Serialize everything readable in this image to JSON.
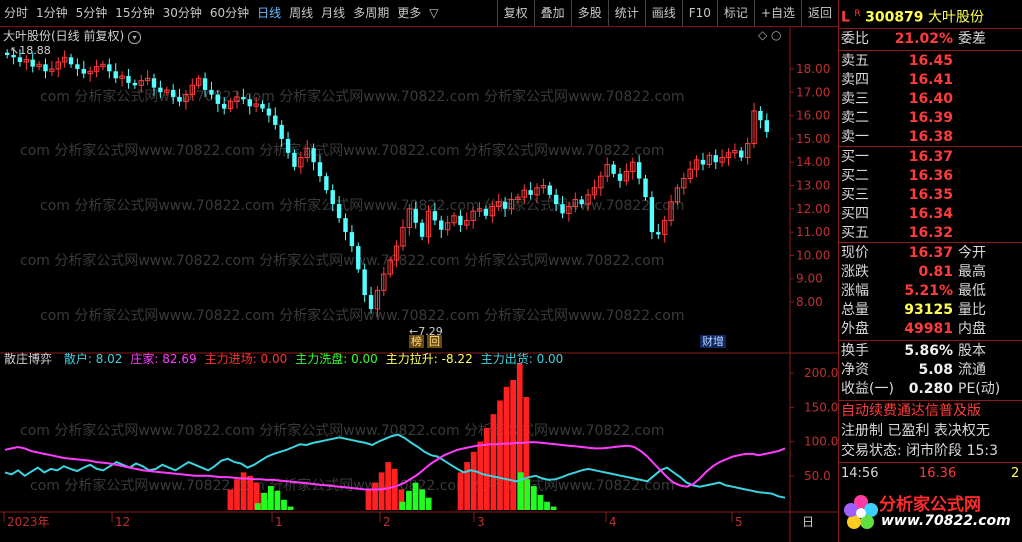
{
  "toolbar": {
    "left": [
      "分时",
      "1分钟",
      "5分钟",
      "15分钟",
      "30分钟",
      "60分钟",
      "日线",
      "周线",
      "月线",
      "多周期",
      "更多"
    ],
    "more_arrow": "▽",
    "right": [
      "复权",
      "叠加",
      "多股",
      "统计",
      "画线",
      "F10",
      "标记",
      "+自选",
      "返回"
    ]
  },
  "main_panel": {
    "title": "大叶股份(日线 前复权)",
    "high_label": "18.88",
    "low_label": "7.29",
    "badges": [
      "榜",
      "回"
    ],
    "event_badge": "财增",
    "watermark": "com 分析家公式网www.70822.com 分析家公式网www.70822.com 分析家公式网www.70822.com"
  },
  "indicator": {
    "name": "散庄博弈",
    "items": [
      {
        "label": "散户: 8.02",
        "color": "#3cd3e0"
      },
      {
        "label": "庄家: 82.69",
        "color": "#ff3cff"
      },
      {
        "label": "主力进场: 0.00",
        "color": "#ff3333"
      },
      {
        "label": "主力洗盘: 0.00",
        "color": "#33ff33"
      },
      {
        "label": "主力拉升: -8.22",
        "color": "#ffff55"
      },
      {
        "label": "主力出货: 0.00",
        "color": "#3cd3e0"
      }
    ]
  },
  "x_axis": [
    "2023年",
    "12",
    "1",
    "2",
    "3",
    "4",
    "5"
  ],
  "x_axis_end": "日",
  "chart_data": [
    {
      "type": "candlestick",
      "title": "大叶股份(日线 前复权)",
      "y_ticks": [
        18.0,
        17.0,
        16.0,
        15.0,
        14.0,
        13.0,
        12.0,
        11.0,
        10.0,
        9.0,
        8.0
      ],
      "ylim": [
        7.1,
        19.2
      ],
      "annotations": {
        "max": 18.88,
        "min": 7.29
      },
      "closes": [
        18.6,
        18.5,
        18.3,
        18.4,
        18.1,
        18.2,
        17.9,
        18.0,
        18.3,
        18.5,
        18.2,
        18.0,
        17.8,
        17.9,
        18.1,
        18.2,
        17.9,
        17.6,
        17.7,
        17.4,
        17.3,
        17.5,
        17.6,
        17.2,
        17.0,
        17.1,
        16.8,
        16.6,
        16.9,
        17.3,
        17.6,
        17.1,
        16.9,
        16.5,
        16.3,
        16.6,
        16.8,
        16.7,
        16.4,
        16.5,
        16.3,
        16.0,
        15.6,
        15.0,
        14.4,
        13.8,
        14.2,
        14.6,
        14.0,
        13.4,
        12.8,
        12.2,
        11.6,
        11.0,
        10.4,
        9.4,
        8.3,
        7.7,
        8.5,
        9.2,
        9.8,
        10.4,
        11.2,
        12.0,
        11.4,
        10.8,
        11.9,
        11.5,
        11.1,
        11.4,
        11.7,
        11.3,
        11.5,
        11.9,
        12.0,
        11.7,
        12.1,
        12.3,
        12.0,
        12.4,
        12.5,
        12.8,
        12.6,
        12.9,
        13.0,
        12.6,
        12.2,
        11.8,
        12.1,
        12.4,
        12.2,
        12.6,
        12.9,
        13.4,
        13.9,
        13.5,
        13.2,
        13.6,
        14.0,
        13.3,
        12.5,
        11.0,
        10.9,
        11.5,
        12.3,
        12.9,
        13.3,
        13.7,
        14.1,
        13.9,
        14.3,
        14.0,
        14.2,
        14.4,
        14.5,
        14.2,
        14.8,
        16.2,
        15.8,
        15.3
      ],
      "y2_ticks": [
        200.0,
        150.0,
        100.0,
        50.0
      ],
      "y2lim": [
        0,
        225
      ],
      "series": [
        {
          "name": "散户",
          "color": "#3cd3e0",
          "values": [
            55,
            52,
            58,
            50,
            56,
            62,
            55,
            60,
            58,
            64,
            60,
            57,
            62,
            66,
            60,
            58,
            64,
            70,
            66,
            62,
            68,
            64,
            58,
            60,
            66,
            62,
            58,
            64,
            70,
            66,
            62,
            58,
            64,
            72,
            75,
            70,
            68,
            62,
            66,
            72,
            78,
            82,
            85,
            88,
            92,
            96,
            95,
            98,
            100,
            102,
            104,
            106,
            104,
            102,
            100,
            98,
            95,
            100,
            104,
            108,
            110,
            105,
            98,
            92,
            85,
            80,
            78,
            72,
            66,
            60,
            55,
            58,
            56,
            52,
            50,
            48,
            46,
            44,
            42,
            45,
            48,
            50,
            46,
            44,
            45,
            48,
            52,
            55,
            58,
            60,
            58,
            56,
            54,
            52,
            50,
            48,
            46,
            44,
            42,
            50,
            58,
            62,
            55,
            48,
            40,
            36,
            34,
            36,
            38,
            40,
            36,
            34,
            32,
            30,
            28,
            26,
            25,
            24,
            20,
            18
          ]
        },
        {
          "name": "庄家",
          "color": "#ff3cff",
          "values": [
            88,
            90,
            92,
            90,
            86,
            84,
            82,
            80,
            78,
            76,
            75,
            74,
            73,
            72,
            70,
            69,
            68,
            66,
            64,
            62,
            60,
            58,
            57,
            56,
            55,
            54,
            53,
            52,
            51,
            50,
            50,
            50,
            49,
            48,
            48,
            47,
            46,
            46,
            45,
            45,
            44,
            44,
            43,
            42,
            41,
            40,
            39,
            38,
            37,
            36,
            35,
            34,
            33,
            32,
            31,
            30,
            30,
            30,
            31,
            33,
            36,
            40,
            46,
            52,
            60,
            68,
            74,
            80,
            84,
            88,
            90,
            92,
            94,
            95,
            96,
            96,
            97,
            97,
            98,
            98,
            99,
            99,
            98,
            97,
            96,
            95,
            94,
            93,
            92,
            91,
            90,
            90,
            91,
            92,
            93,
            94,
            92,
            86,
            78,
            68,
            58,
            48,
            40,
            36,
            34,
            38,
            46,
            56,
            64,
            70,
            74,
            78,
            80,
            82,
            82,
            80,
            82,
            84,
            86,
            90
          ]
        },
        {
          "name": "主力拉升",
          "color": "#ff2020",
          "start": 30,
          "values": [
            0,
            0,
            0,
            0,
            30,
            45,
            55,
            50,
            40,
            25,
            15,
            0,
            0,
            0,
            0,
            0,
            0,
            0,
            0,
            0,
            0,
            0,
            0,
            0,
            0,
            30,
            40,
            55,
            70,
            60,
            30,
            0,
            0,
            0,
            0,
            0,
            0,
            0,
            0,
            55,
            70,
            85,
            100,
            120,
            140,
            160,
            180,
            190,
            215,
            165
          ]
        },
        {
          "name": "主力洗盘",
          "color": "#20ff20",
          "start": 30,
          "values": [
            0,
            0,
            0,
            0,
            0,
            0,
            0,
            0,
            10,
            25,
            35,
            28,
            15,
            5,
            0,
            0,
            0,
            0,
            0,
            0,
            0,
            0,
            0,
            0,
            0,
            0,
            0,
            0,
            0,
            0,
            12,
            28,
            40,
            30,
            18,
            0,
            0,
            0,
            0,
            0,
            0,
            0,
            0,
            0,
            0,
            0,
            0,
            0,
            55,
            45,
            35,
            22,
            12,
            5
          ]
        }
      ]
    }
  ],
  "quote": {
    "code": "300879",
    "name": "大叶股份",
    "flag_l": "L",
    "flag_r": "R",
    "weibi_label": "委比",
    "weibi": "21.02%",
    "weicha_label": "委差",
    "asks": [
      {
        "label": "卖五",
        "price": "16.45"
      },
      {
        "label": "卖四",
        "price": "16.41"
      },
      {
        "label": "卖三",
        "price": "16.40"
      },
      {
        "label": "卖二",
        "price": "16.39"
      },
      {
        "label": "卖一",
        "price": "16.38"
      }
    ],
    "bids": [
      {
        "label": "买一",
        "price": "16.37"
      },
      {
        "label": "买二",
        "price": "16.36"
      },
      {
        "label": "买三",
        "price": "16.35"
      },
      {
        "label": "买四",
        "price": "16.34"
      },
      {
        "label": "买五",
        "price": "16.32"
      }
    ],
    "stats": [
      {
        "label": "现价",
        "value": "16.37",
        "color": "#ff3b3b",
        "r": "今开"
      },
      {
        "label": "涨跌",
        "value": "0.81",
        "color": "#ff3b3b",
        "r": "最高"
      },
      {
        "label": "涨幅",
        "value": "5.21%",
        "color": "#ff3b3b",
        "r": "最低"
      },
      {
        "label": "总量",
        "value": "93125",
        "color": "#ffff55",
        "r": "量比"
      },
      {
        "label": "外盘",
        "value": "49981",
        "color": "#ff3b3b",
        "r": "内盘"
      }
    ],
    "stats2": [
      {
        "label": "换手",
        "value": "5.86%",
        "r": "股本"
      },
      {
        "label": "净资",
        "value": "5.08",
        "r": "流通"
      },
      {
        "label": "收益(一)",
        "value": "0.280",
        "r": "PE(动)"
      }
    ],
    "notice1": "自动续费通达信普及版",
    "notice2": "注册制 已盈利 表决权无",
    "notice3": "交易状态: 闭市阶段 15:3",
    "tick_time": "14:56",
    "tick_price": "16.36",
    "tick_vol": "2"
  },
  "logo": {
    "text": "分析家公式网",
    "url": "www.70822.com"
  }
}
